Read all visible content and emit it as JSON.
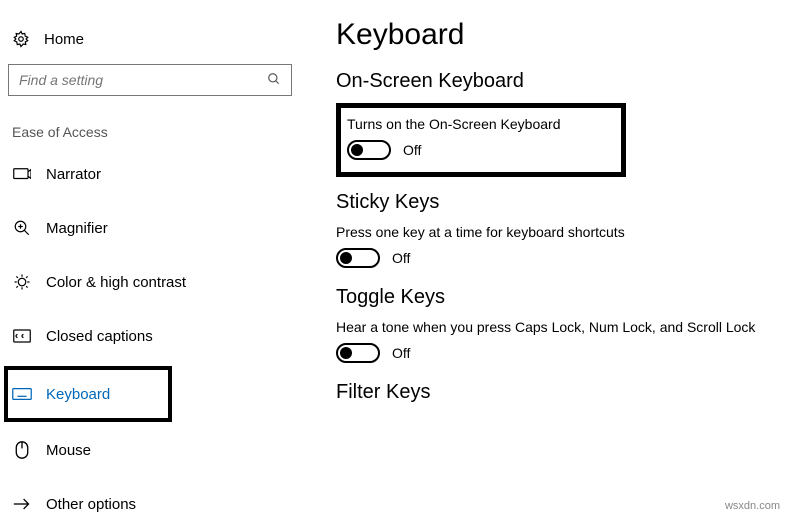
{
  "sidebar": {
    "home": "Home",
    "search_placeholder": "Find a setting",
    "group_header": "Ease of Access",
    "items": [
      {
        "label": "Narrator"
      },
      {
        "label": "Magnifier"
      },
      {
        "label": "Color & high contrast"
      },
      {
        "label": "Closed captions"
      },
      {
        "label": "Keyboard"
      },
      {
        "label": "Mouse"
      },
      {
        "label": "Other options"
      }
    ]
  },
  "page": {
    "title": "Keyboard",
    "osk": {
      "heading": "On-Screen Keyboard",
      "desc": "Turns on the On-Screen Keyboard",
      "state": "Off"
    },
    "sticky": {
      "heading": "Sticky Keys",
      "desc": "Press one key at a time for keyboard shortcuts",
      "state": "Off"
    },
    "toggle": {
      "heading": "Toggle Keys",
      "desc": "Hear a tone when you press Caps Lock, Num Lock, and Scroll Lock",
      "state": "Off"
    },
    "filter": {
      "heading": "Filter Keys"
    }
  },
  "watermark": "wsxdn.com"
}
